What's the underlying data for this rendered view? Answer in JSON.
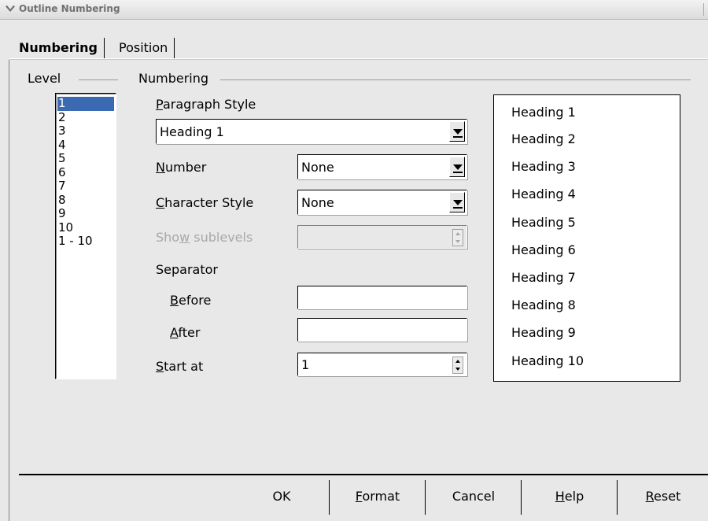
{
  "window": {
    "title": "Outline Numbering"
  },
  "tabs": [
    {
      "label": "Numbering",
      "selected": true
    },
    {
      "label": "Position",
      "selected": false
    }
  ],
  "level": {
    "group_label": "Level",
    "items": [
      "1",
      "2",
      "3",
      "4",
      "5",
      "6",
      "7",
      "8",
      "9",
      "10",
      "1 - 10"
    ],
    "selected": "1"
  },
  "numbering": {
    "group_label": "Numbering",
    "paragraph_style": {
      "label_u": "P",
      "label_rest": "aragraph Style",
      "value": "Heading 1"
    },
    "number": {
      "label_u": "N",
      "label_rest": "umber",
      "value": "None"
    },
    "character_style": {
      "label_u": "C",
      "label_rest": "haracter Style",
      "value": "None"
    },
    "show_sublevels": {
      "label_pre": "Sho",
      "label_u": "w",
      "label_rest": " sublevels",
      "value": ""
    },
    "separator_label": "Separator",
    "before": {
      "label_u": "B",
      "label_rest": "efore",
      "value": ""
    },
    "after": {
      "label_u": "A",
      "label_rest": "fter",
      "value": ""
    },
    "start_at": {
      "label_u": "S",
      "label_rest": "tart at",
      "value": "1"
    }
  },
  "preview": {
    "items": [
      "Heading 1",
      "Heading 2",
      "Heading 3",
      "Heading 4",
      "Heading 5",
      "Heading 6",
      "Heading 7",
      "Heading 8",
      "Heading 9",
      "Heading 10"
    ]
  },
  "buttons": {
    "ok": "OK",
    "format_u": "F",
    "format_rest": "ormat",
    "cancel": "Cancel",
    "help_u": "H",
    "help_rest": "elp",
    "reset_u": "R",
    "reset_rest": "eset"
  }
}
